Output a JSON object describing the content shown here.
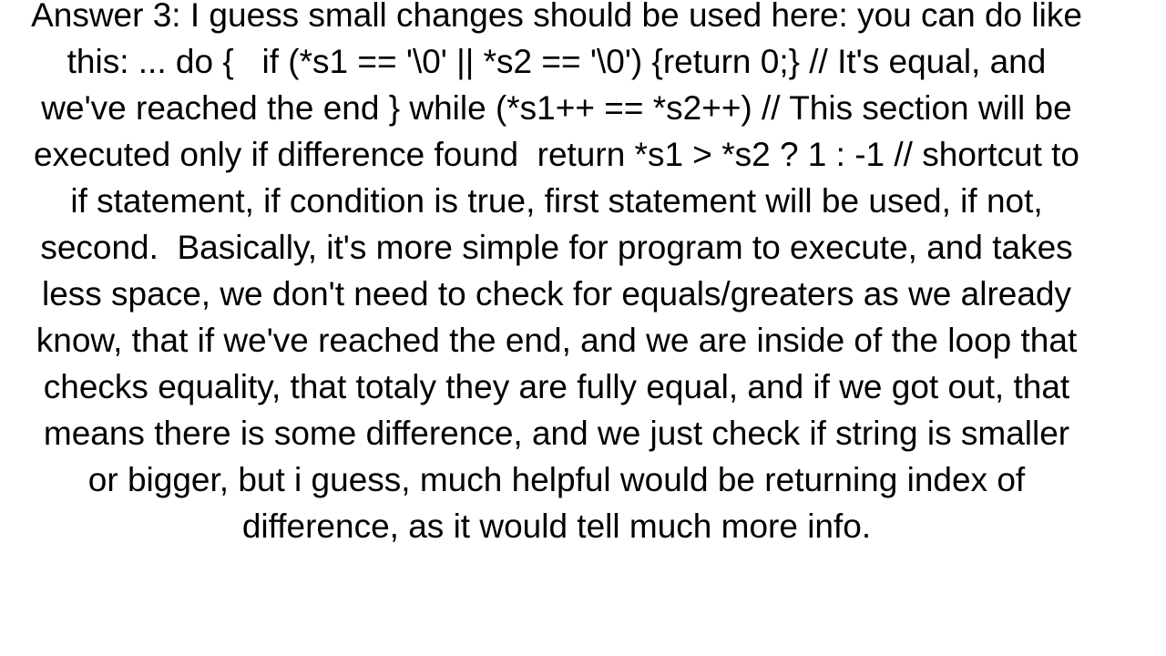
{
  "page": {
    "background_color": "#ffffff",
    "text_color": "#000000",
    "alignment": "center"
  },
  "answer": {
    "label": "Answer 3",
    "full_text": "Answer 3: I guess small changes should be used here: you can do like this: ... do {   if (*s1 == '\\0' || *s2 == '\\0') {return 0;} // It's equal, and we've reached the end } while (*s1++ == *s2++) // This section will be executed only if difference found  return *s1 > *s2 ? 1 : -1 // shortcut to if statement, if condition is true, first statement will be used, if not, second.  Basically, it's more simple for program to execute, and takes less space, we don't need to check for equals/greaters as we already know, that if we've reached the end, and we are inside of the loop that checks equality, that totaly they are fully equal, and if we got out, that means there is some difference, and we just check if string is smaller or bigger, but i guess, much helpful would be returning index of difference, as it would tell much more info.",
    "lines": [
      "Answer 3: I guess small changes should be used here: you can",
      "do like this: ... do {   if (*s1 == '\\0' || *s2 == '\\0')",
      "{return 0;} // It's equal, and we've reached the end } while",
      "(*s1++ == *s2++) // This section will be executed only if",
      "difference found  return *s1 > *s2 ? 1 : -1 // shortcut to",
      "if statement, if condition is true, first statement will be",
      "used, if not, second.  Basically, it's more simple for",
      "program to execute, and takes less space, we don't need to",
      "check for equals/greaters as we already know, that if we've",
      "reached the end, and we are inside of the loop that checks",
      "equality, that totaly they are fully equal, and if we got",
      "out, that means there is some difference, and we just check",
      "if string is smaller or bigger, but i guess, much helpful",
      "would be returning index of difference, as it would tell",
      "much more info."
    ]
  }
}
